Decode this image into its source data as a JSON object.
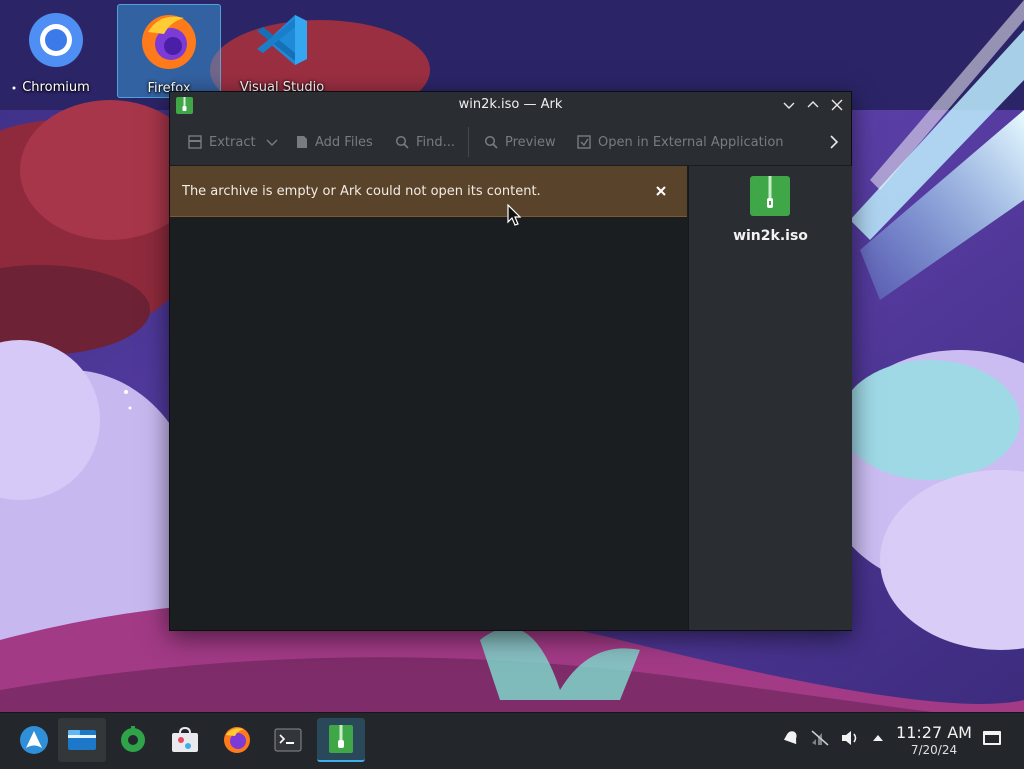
{
  "desktop": {
    "icons": [
      {
        "label": "Chromium",
        "icon": "chromium-icon"
      },
      {
        "label": "Firefox",
        "icon": "firefox-icon",
        "selected": true
      },
      {
        "label": "Visual Studio",
        "icon": "vscode-icon"
      }
    ]
  },
  "window": {
    "title": "win2k.iso — Ark",
    "app_icon": "ark-icon",
    "toolbar": {
      "extract": "Extract",
      "add_files": "Add Files",
      "find": "Find...",
      "preview": "Preview",
      "open_external": "Open in External Application"
    },
    "message": "The archive is empty or Ark could not open its content.",
    "info_panel": {
      "file_name": "win2k.iso"
    }
  },
  "taskbar": {
    "launchers": [
      "arch-menu-icon",
      "dolphin-icon",
      "system-settings-icon",
      "discover-icon",
      "firefox-icon",
      "konsole-icon",
      "ark-icon"
    ],
    "clock": {
      "time": "11:27 AM",
      "date": "7/20/24"
    }
  },
  "colors": {
    "accent": "#3daee9",
    "message_background": "#5a432b",
    "ark_green": "#3fa748"
  }
}
